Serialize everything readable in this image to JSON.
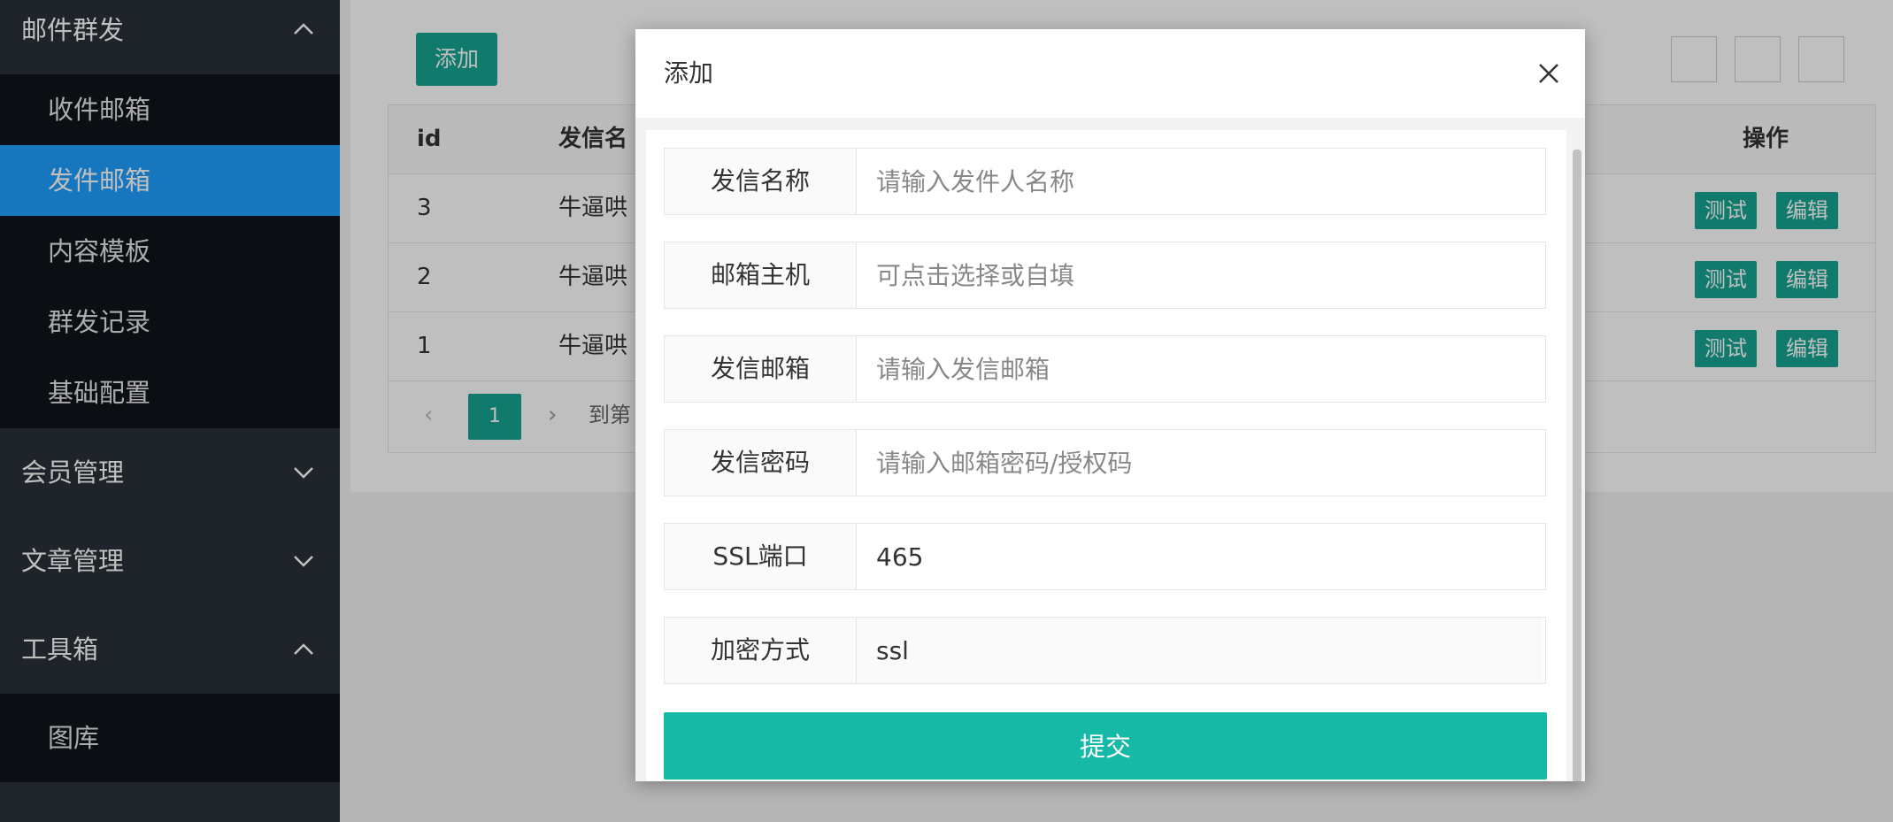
{
  "sidebar": {
    "email_group": {
      "label": "邮件群发"
    },
    "email_items": [
      {
        "label": "收件邮箱"
      },
      {
        "label": "发件邮箱"
      },
      {
        "label": "内容模板"
      },
      {
        "label": "群发记录"
      },
      {
        "label": "基础配置"
      }
    ],
    "member_group": {
      "label": "会员管理"
    },
    "article_group": {
      "label": "文章管理"
    },
    "toolbox_group": {
      "label": "工具箱"
    },
    "toolbox_items": [
      {
        "label": "图库"
      }
    ]
  },
  "background": {
    "add_button": "添加",
    "table": {
      "headers": {
        "id": "id",
        "name": "发信名",
        "op": "操作"
      },
      "rows": [
        {
          "id": "3",
          "name": "牛逼哄"
        },
        {
          "id": "2",
          "name": "牛逼哄"
        },
        {
          "id": "1",
          "name": "牛逼哄"
        }
      ],
      "test_label": "测试",
      "edit_label": "编辑"
    },
    "pager": {
      "current": "1",
      "goto_text": "到第"
    }
  },
  "modal": {
    "title": "添加",
    "fields": [
      {
        "label": "发信名称",
        "value": "",
        "placeholder": "请输入发件人名称"
      },
      {
        "label": "邮箱主机",
        "value": "",
        "placeholder": "可点击选择或自填"
      },
      {
        "label": "发信邮箱",
        "value": "",
        "placeholder": "请输入发信邮箱"
      },
      {
        "label": "发信密码",
        "value": "",
        "placeholder": "请输入邮箱密码/授权码"
      },
      {
        "label": "SSL端口",
        "value": "465",
        "placeholder": ""
      },
      {
        "label": "加密方式",
        "value": "ssl",
        "placeholder": ""
      }
    ],
    "submit_label": "提交"
  },
  "colors": {
    "accent": "#16a492",
    "active_menu": "#1e9fff",
    "sidebar_bg": "#2a313a"
  }
}
